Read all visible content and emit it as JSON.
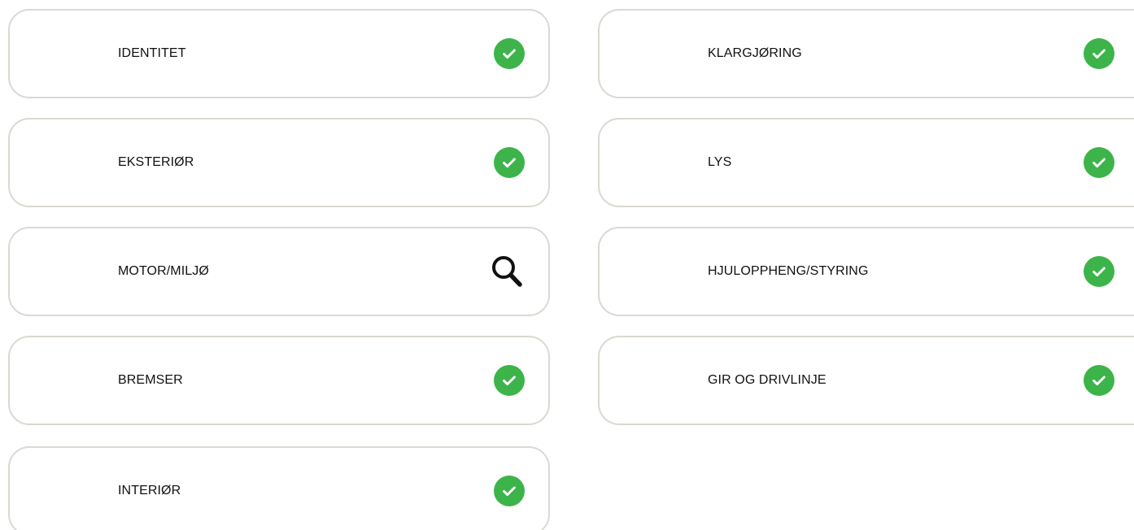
{
  "accent_color": "#3cb44a",
  "categories": [
    {
      "label": "IDENTITET",
      "status": "complete",
      "icon": "check-circle-icon"
    },
    {
      "label": "EKSTERIØR",
      "status": "complete",
      "icon": "check-circle-icon"
    },
    {
      "label": "MOTOR/MILJØ",
      "status": "in-review",
      "icon": "magnifier-icon"
    },
    {
      "label": "BREMSER",
      "status": "complete",
      "icon": "check-circle-icon"
    },
    {
      "label": "INTERIØR",
      "status": "complete",
      "icon": "check-circle-icon"
    },
    {
      "label": "KLARGJØRING",
      "status": "complete",
      "icon": "check-circle-icon"
    },
    {
      "label": "LYS",
      "status": "complete",
      "icon": "check-circle-icon"
    },
    {
      "label": "HJULOPPHENG/STYRING",
      "status": "complete",
      "icon": "check-circle-icon"
    },
    {
      "label": "GIR OG DRIVLINJE",
      "status": "complete",
      "icon": "check-circle-icon"
    }
  ]
}
